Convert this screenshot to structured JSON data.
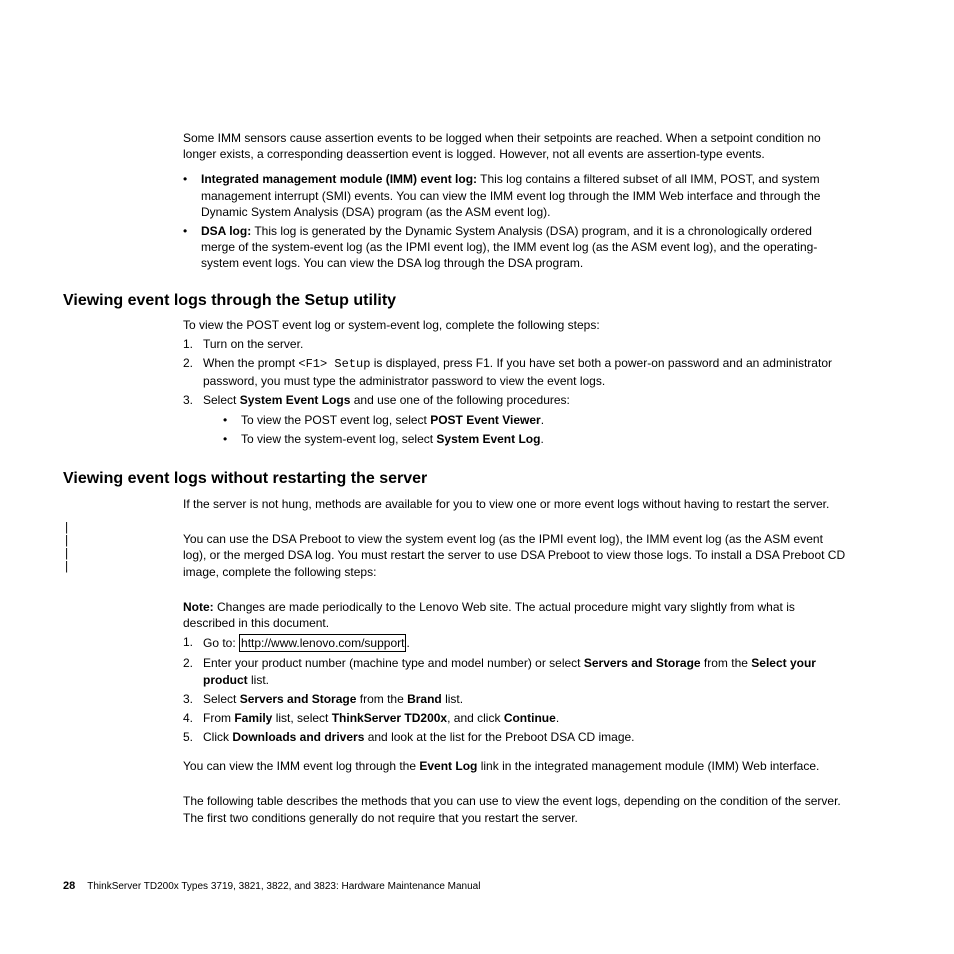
{
  "intro_p1": "Some IMM sensors cause assertion events to be logged when their setpoints are reached. When a setpoint condition no longer exists, a corresponding deassertion event is logged. However, not all events are assertion-type events.",
  "bullet1_bold": "Integrated management module (IMM) event log:",
  "bullet1_text": " This log contains a filtered subset of all IMM, POST, and system management interrupt (SMI) events. You can view the IMM event log through the IMM Web interface and through the Dynamic System Analysis (DSA) program (as the ASM event log).",
  "bullet2_bold": "DSA log:",
  "bullet2_text": " This log is generated by the Dynamic System Analysis (DSA) program, and it is a chronologically ordered merge of the system-event log (as the IPMI event log), the IMM event log (as the ASM event log), and the operating-system event logs. You can view the DSA log through the DSA program.",
  "h2a": "Viewing event logs through the Setup utility",
  "seca_intro": "To view the POST event log or system-event log, complete the following steps:",
  "seca_s1": "Turn on the server.",
  "seca_s2a": "When the prompt ",
  "seca_s2code": "<F1> Setup",
  "seca_s2b": " is displayed, press F1. If you have set both a power-on password and an administrator password, you must type the administrator password to view the event logs.",
  "seca_s3a": "Select ",
  "seca_s3bold": "System Event Logs",
  "seca_s3b": " and use one of the following procedures:",
  "seca_s3i1a": "To view the POST event log, select ",
  "seca_s3i1bold": "POST Event Viewer",
  "seca_s3i1b": ".",
  "seca_s3i2a": "To view the system-event log, select ",
  "seca_s3i2bold": "System Event Log",
  "seca_s3i2b": ".",
  "h2b": "Viewing event logs without restarting the server",
  "secb_p1": "If the server is not hung, methods are available for you to view one or more event logs without having to restart the server.",
  "secb_p2": "You can use the DSA Preboot to view the system event log (as the IPMI event log), the IMM event log (as the ASM event log), or the merged DSA log. You must restart the server to use DSA Preboot to view those logs. To install a DSA Preboot CD image, complete the following steps:",
  "secb_note_bold": "Note:",
  "secb_note_text": "  Changes are made periodically to the Lenovo Web site. The actual procedure might vary slightly from what is described in this document.",
  "secb_s1a": "Go to: ",
  "secb_s1link": "http://www.lenovo.com/support",
  "secb_s1b": ".",
  "secb_s2a": "Enter your product number (machine type and model number) or select ",
  "secb_s2bold1": "Servers and Storage",
  "secb_s2b": " from the ",
  "secb_s2bold2": "Select your product",
  "secb_s2c": " list.",
  "secb_s3a": "Select ",
  "secb_s3bold1": "Servers and Storage",
  "secb_s3b": " from the ",
  "secb_s3bold2": "Brand",
  "secb_s3c": " list.",
  "secb_s4a": "From ",
  "secb_s4bold1": "Family",
  "secb_s4b": " list, select ",
  "secb_s4bold2": "ThinkServer TD200x",
  "secb_s4c": ", and click ",
  "secb_s4bold3": "Continue",
  "secb_s4d": ".",
  "secb_s5a": "Click ",
  "secb_s5bold": "Downloads and drivers",
  "secb_s5b": " and look at the list for the Preboot DSA CD image.",
  "secb_p3a": "You can view the IMM event log through the ",
  "secb_p3bold": "Event Log",
  "secb_p3b": " link in the integrated management module (IMM) Web interface.",
  "secb_p4": "The following table describes the methods that you can use to view the event logs, depending on the condition of the server. The first two conditions generally do not require that you restart the server.",
  "footer_page": "28",
  "footer_text": "ThinkServer TD200x Types 3719, 3821, 3822, and 3823: Hardware Maintenance Manual"
}
